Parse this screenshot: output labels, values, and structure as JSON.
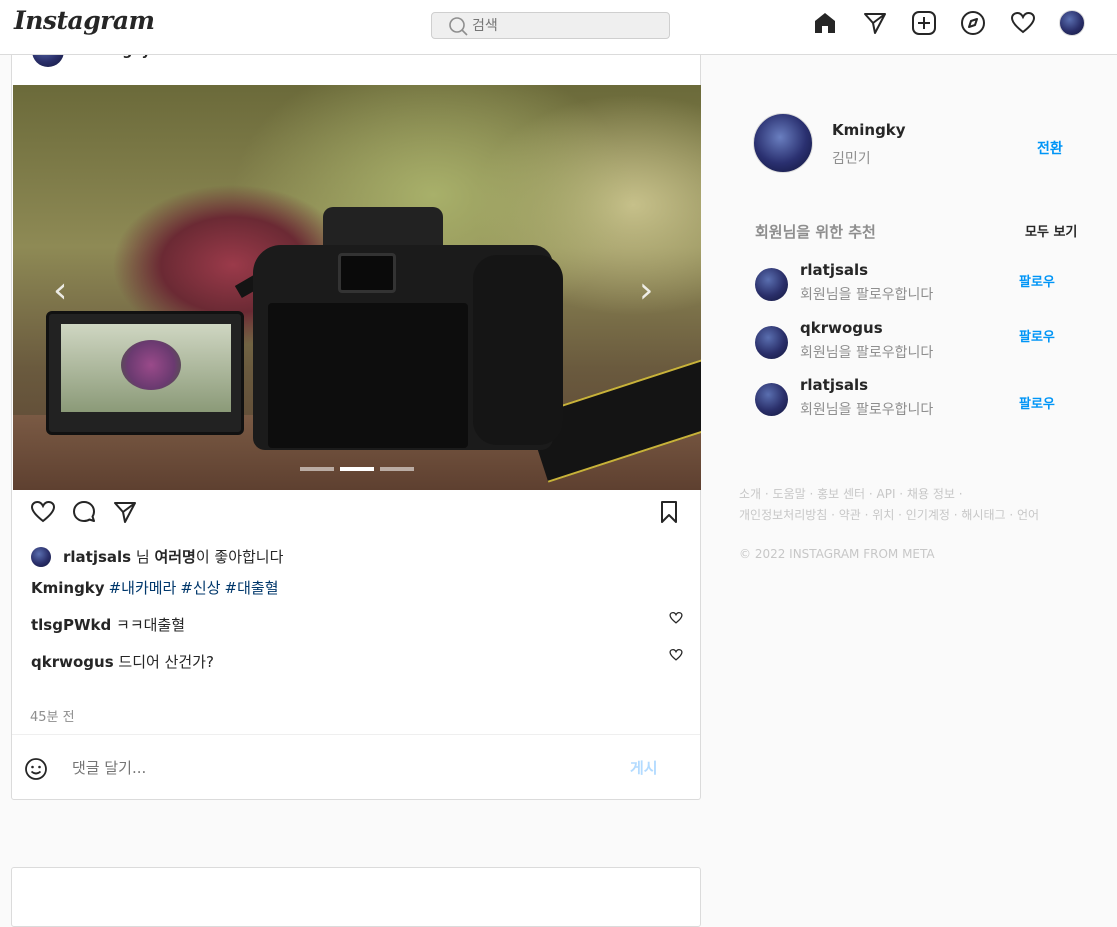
{
  "header": {
    "logo": "Instagram",
    "search_placeholder": "검색"
  },
  "post": {
    "author": "Kmingky",
    "liked_by_user": "rlatjsals",
    "liked_by_mid": " 님 ",
    "liked_by_others": "여러명",
    "liked_by_suffix": "이 좋아합니다",
    "caption_user": "Kmingky",
    "caption_tags": [
      "#내카메라",
      "#신상",
      "#대출혈"
    ],
    "comments": [
      {
        "user": "tlsgPWkd",
        "text": "ㅋㅋ대출혈"
      },
      {
        "user": "qkrwogus",
        "text": "드디어 산건가?"
      }
    ],
    "time": "45분 전",
    "comment_placeholder": "댓글 달기...",
    "post_button": "게시",
    "carousel_slides": 3,
    "carousel_active_index": 1
  },
  "sidebar": {
    "username": "Kmingky",
    "fullname": "김민기",
    "switch_label": "전환",
    "suggest_title": "회원님을 위한 추천",
    "see_all": "모두 보기",
    "suggestions": [
      {
        "name": "rlatjsals",
        "sub": "회원님을 팔로우합니다",
        "follow": "팔로우"
      },
      {
        "name": "qkrwogus",
        "sub": "회원님을 팔로우합니다",
        "follow": "팔로우"
      },
      {
        "name": "rlatjsals",
        "sub": "회원님을 팔로우합니다",
        "follow": "팔로우"
      }
    ],
    "footer_line1": "소개 · 도움말 · 홍보 센터 · API · 채용 정보 ·",
    "footer_line2": "개인정보처리방침 · 약관 · 위치 · 인기계정 · 해시태그 · 언어",
    "copyright": "© 2022 INSTAGRAM FROM META"
  },
  "colors": {
    "accent": "#0095f6",
    "hashtag": "#00376b",
    "muted": "#8e8e8e",
    "border": "#dbdbdb"
  }
}
